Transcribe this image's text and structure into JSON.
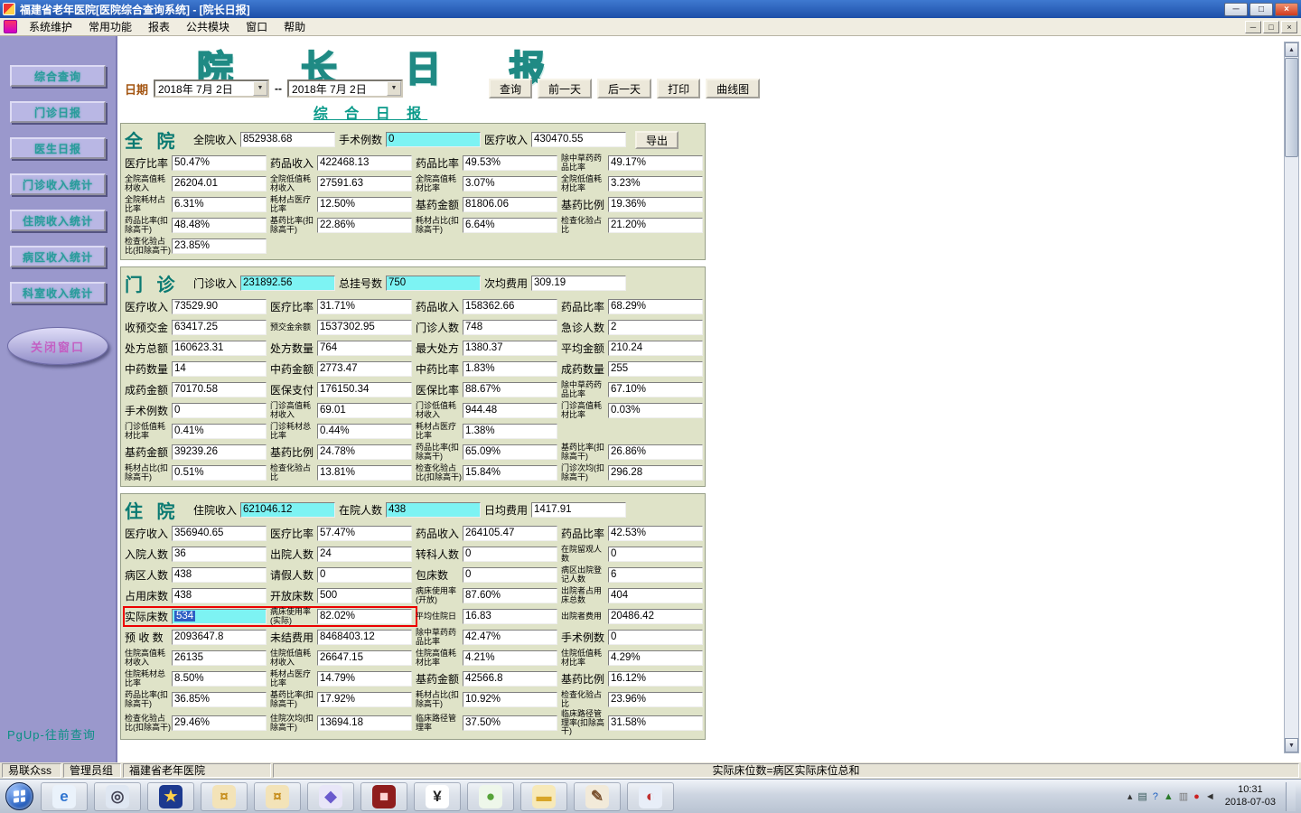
{
  "window": {
    "title": "福建省老年医院[医院综合查询系统] - [院长日报]",
    "menus": [
      "系统维护",
      "常用功能",
      "报表",
      "公共模块",
      "窗口",
      "帮助"
    ],
    "controls": {
      "min": "─",
      "max": "□",
      "close": "×"
    },
    "mdi": {
      "min": "─",
      "restore": "□",
      "close": "×"
    }
  },
  "icons": {
    "down": "▼",
    "up": "▲"
  },
  "sidebar": {
    "buttons": [
      "综合查询",
      "门诊日报",
      "医生日报",
      "门诊收入统计",
      "住院收入统计",
      "病区收入统计",
      "科室收入统计"
    ],
    "close_button": "关闭窗口",
    "pgup_hint": "PgUp-往前查询"
  },
  "report": {
    "deco_title": "院 长 日 报",
    "date_label": "日期",
    "date_from": "2018年 7月 2日",
    "date_to": "2018年 7月 2日",
    "range_sep": "--",
    "toolbar": [
      "查询",
      "前一天",
      "后一天",
      "打印",
      "曲线图"
    ],
    "section_header": "综 合 日 报"
  },
  "sections": [
    {
      "id": "hospital",
      "title": "全 院",
      "header": [
        {
          "l": "全院收入",
          "v": "852938.68"
        },
        {
          "l": "手术例数",
          "v": "0",
          "hl": 1
        },
        {
          "l": "医疗收入",
          "v": "430470.55"
        }
      ],
      "export_label": "导出",
      "rows": [
        [
          {
            "l": "医疗比率",
            "v": "50.47%"
          },
          {
            "l": "药品收入",
            "v": "422468.13"
          },
          {
            "l": "药品比率",
            "v": "49.53%"
          },
          {
            "l": "除中草药药品比率",
            "v": "49.17%"
          }
        ],
        [
          {
            "l": "全院高值耗材收入",
            "v": "26204.01"
          },
          {
            "l": "全院低值耗材收入",
            "v": "27591.63"
          },
          {
            "l": "全院高值耗材比率",
            "v": "3.07%"
          },
          {
            "l": "全院低值耗材比率",
            "v": "3.23%"
          }
        ],
        [
          {
            "l": "全院耗材占比率",
            "v": "6.31%"
          },
          {
            "l": "耗材占医疗比率",
            "v": "12.50%"
          },
          {
            "l": "基药金额",
            "v": "81806.06"
          },
          {
            "l": "基药比例",
            "v": "19.36%"
          }
        ],
        [
          {
            "l": "药品比率(扣除高干)",
            "v": "48.48%"
          },
          {
            "l": "基药比率(扣除高干)",
            "v": "22.86%"
          },
          {
            "l": "耗材占比(扣除高干)",
            "v": "6.64%"
          },
          {
            "l": "检查化验占比",
            "v": "21.20%"
          }
        ],
        [
          {
            "l": "检查化验占比(扣除高干)",
            "v": "23.85%"
          }
        ]
      ]
    },
    {
      "id": "outpatient",
      "title": "门 诊",
      "header": [
        {
          "l": "门诊收入",
          "v": "231892.56",
          "hl": 1
        },
        {
          "l": "总挂号数",
          "v": "750",
          "hl": 1
        },
        {
          "l": "次均费用",
          "v": "309.19"
        }
      ],
      "rows": [
        [
          {
            "l": "医疗收入",
            "v": "73529.90"
          },
          {
            "l": "医疗比率",
            "v": "31.71%"
          },
          {
            "l": "药品收入",
            "v": "158362.66"
          },
          {
            "l": "药品比率",
            "v": "68.29%"
          }
        ],
        [
          {
            "l": "收预交金",
            "v": "63417.25"
          },
          {
            "l": "预交金余额",
            "v": "1537302.95"
          },
          {
            "l": "门诊人数",
            "v": "748"
          },
          {
            "l": "急诊人数",
            "v": "2"
          }
        ],
        [
          {
            "l": "处方总额",
            "v": "160623.31"
          },
          {
            "l": "处方数量",
            "v": "764"
          },
          {
            "l": "最大处方",
            "v": "1380.37"
          },
          {
            "l": "平均金额",
            "v": "210.24"
          }
        ],
        [
          {
            "l": "中药数量",
            "v": "14"
          },
          {
            "l": "中药金额",
            "v": "2773.47"
          },
          {
            "l": "中药比率",
            "v": "1.83%"
          },
          {
            "l": "成药数量",
            "v": "255"
          }
        ],
        [
          {
            "l": "成药金额",
            "v": "70170.58"
          },
          {
            "l": "医保支付",
            "v": "176150.34"
          },
          {
            "l": "医保比率",
            "v": "88.67%"
          },
          {
            "l": "除中草药药品比率",
            "v": "67.10%"
          }
        ],
        [
          {
            "l": "手术例数",
            "v": "0"
          },
          {
            "l": "门诊高值耗材收入",
            "v": "69.01"
          },
          {
            "l": "门诊低值耗材收入",
            "v": "944.48"
          },
          {
            "l": "门诊高值耗材比率",
            "v": "0.03%"
          }
        ],
        [
          {
            "l": "门诊低值耗材比率",
            "v": "0.41%"
          },
          {
            "l": "门诊耗材总比率",
            "v": "0.44%"
          },
          {
            "l": "耗材占医疗比率",
            "v": "1.38%"
          }
        ],
        [
          {
            "l": "基药金额",
            "v": "39239.26"
          },
          {
            "l": "基药比例",
            "v": "24.78%"
          },
          {
            "l": "药品比率(扣除高干)",
            "v": "65.09%"
          },
          {
            "l": "基药比率(扣除高干)",
            "v": "26.86%"
          }
        ],
        [
          {
            "l": "耗材占比(扣除高干)",
            "v": "0.51%"
          },
          {
            "l": "检查化验占比",
            "v": "13.81%"
          },
          {
            "l": "检查化验占比(扣除高干)",
            "v": "15.84%"
          },
          {
            "l": "门诊次均(扣除高干)",
            "v": "296.28"
          }
        ]
      ]
    },
    {
      "id": "inpatient",
      "title": "住 院",
      "header": [
        {
          "l": "住院收入",
          "v": "621046.12",
          "hl": 1
        },
        {
          "l": "在院人数",
          "v": "438",
          "hl": 1
        },
        {
          "l": "日均费用",
          "v": "1417.91"
        }
      ],
      "red_row": 4,
      "red_span": 2,
      "rows": [
        [
          {
            "l": "医疗收入",
            "v": "356940.65"
          },
          {
            "l": "医疗比率",
            "v": "57.47%"
          },
          {
            "l": "药品收入",
            "v": "264105.47"
          },
          {
            "l": "药品比率",
            "v": "42.53%"
          }
        ],
        [
          {
            "l": "入院人数",
            "v": "36"
          },
          {
            "l": "出院人数",
            "v": "24"
          },
          {
            "l": "转科人数",
            "v": "0"
          },
          {
            "l": "在院留观人数",
            "v": "0"
          }
        ],
        [
          {
            "l": "病区人数",
            "v": "438"
          },
          {
            "l": "请假人数",
            "v": "0"
          },
          {
            "l": "包床数",
            "v": "0"
          },
          {
            "l": "病区出院登记人数",
            "v": "6"
          }
        ],
        [
          {
            "l": "占用床数",
            "v": "438"
          },
          {
            "l": "开放床数",
            "v": "500"
          },
          {
            "l": "病床使用率(开放)",
            "v": "87.60%"
          },
          {
            "l": "出院者占用床总数",
            "v": "404"
          }
        ],
        [
          {
            "l": "实际床数",
            "v": "534",
            "hl": 1,
            "sel": 1
          },
          {
            "l": "病床使用率(实际)",
            "v": "82.02%"
          },
          {
            "l": "平均住院日",
            "v": "16.83"
          },
          {
            "l": "出院者费用",
            "v": "20486.42"
          }
        ],
        [
          {
            "l": "预 收 数",
            "v": "2093647.8"
          },
          {
            "l": "未结费用",
            "v": "8468403.12"
          },
          {
            "l": "除中草药药品比率",
            "v": "42.47%"
          },
          {
            "l": "手术例数",
            "v": "0"
          }
        ],
        [
          {
            "l": "住院高值耗材收入",
            "v": "26135"
          },
          {
            "l": "住院低值耗材收入",
            "v": "26647.15"
          },
          {
            "l": "住院高值耗材比率",
            "v": "4.21%"
          },
          {
            "l": "住院低值耗材比率",
            "v": "4.29%"
          }
        ],
        [
          {
            "l": "住院耗材总比率",
            "v": "8.50%"
          },
          {
            "l": "耗材占医疗比率",
            "v": "14.79%"
          },
          {
            "l": "基药金额",
            "v": "42566.8"
          },
          {
            "l": "基药比例",
            "v": "16.12%"
          }
        ],
        [
          {
            "l": "药品比率(扣除高干)",
            "v": "36.85%"
          },
          {
            "l": "基药比率(扣除高干)",
            "v": "17.92%"
          },
          {
            "l": "耗材占比(扣除高干)",
            "v": "10.92%"
          },
          {
            "l": "检查化验占比",
            "v": "23.96%"
          }
        ],
        [
          {
            "l": "检查化验占比(扣除高干)",
            "v": "29.46%"
          },
          {
            "l": "住院次均(扣除高干)",
            "v": "13694.18"
          },
          {
            "l": "临床路径管理率",
            "v": "37.50%"
          },
          {
            "l": "临床路径管理率(扣除高干)",
            "v": "31.58%"
          }
        ]
      ]
    }
  ],
  "statusbar": {
    "items": [
      "易联众ss",
      "管理员组",
      "福建省老年医院",
      "实际床位数=病区实际床位总和"
    ]
  },
  "taskbar": {
    "apps": [
      {
        "name": "ie-browser",
        "glyph": "e",
        "bg": "#eaf2fb",
        "fg": "#2f74d0"
      },
      {
        "name": "magnifier-app",
        "glyph": "◎",
        "bg": "#dfe7f2",
        "fg": "#445"
      },
      {
        "name": "compass-app",
        "glyph": "★",
        "bg": "#1d3a8f",
        "fg": "#ffd24a"
      },
      {
        "name": "coins-app-1",
        "glyph": "¤",
        "bg": "#f3e3b8",
        "fg": "#c78f1f"
      },
      {
        "name": "coins-app-2",
        "glyph": "¤",
        "bg": "#f3e3b8",
        "fg": "#c78f1f"
      },
      {
        "name": "diamond-app",
        "glyph": "◆",
        "bg": "#e8e6f8",
        "fg": "#6a5acd"
      },
      {
        "name": "alert-app",
        "glyph": "■",
        "bg": "#8f1d1d",
        "fg": "#ffd2d2"
      },
      {
        "name": "yen-app",
        "glyph": "¥",
        "bg": "#ffffff",
        "fg": "#222"
      },
      {
        "name": "apple-app",
        "glyph": "●",
        "bg": "#eef7ea",
        "fg": "#57a33a"
      },
      {
        "name": "folder-app",
        "glyph": "▬",
        "bg": "#f7e9b8",
        "fg": "#d8a528"
      },
      {
        "name": "pen-app",
        "glyph": "✎",
        "bg": "#f2ead9",
        "fg": "#7a5230"
      },
      {
        "name": "sphere-app",
        "glyph": "◐",
        "bg": "#e8eef8",
        "fg": "#c03030"
      }
    ],
    "tray": [
      {
        "name": "hidden-icons",
        "glyph": "▴",
        "color": "#333"
      },
      {
        "name": "display",
        "glyph": "▤",
        "color": "#355"
      },
      {
        "name": "help",
        "glyph": "?",
        "color": "#1d5fc0"
      },
      {
        "name": "eject",
        "glyph": "▲",
        "color": "#2a7a2a"
      },
      {
        "name": "media",
        "glyph": "▥",
        "color": "#777"
      },
      {
        "name": "alert",
        "glyph": "●",
        "color": "#c22"
      },
      {
        "name": "volume",
        "glyph": "◄",
        "color": "#333"
      }
    ],
    "time": "10:31",
    "date": "2018-07-03"
  }
}
